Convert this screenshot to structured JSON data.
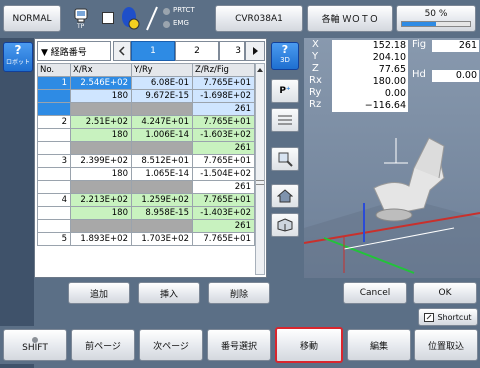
{
  "header": {
    "mode_label": "NORMAL",
    "tp_label": "TP",
    "prtct_label": "PRTCT",
    "emg_label": "EMG",
    "robot_name": "CVR038A1",
    "axis_label": "各軸 ＷＯＴＯ",
    "speed_label": "50 %",
    "speed_value": 0.5
  },
  "left_panel": {
    "robot_button_label": "ロボット",
    "help_glyph": "?"
  },
  "table": {
    "title": "▼ 経路番号",
    "tabs": [
      "1",
      "2",
      "3"
    ],
    "active_tab": "1",
    "col_headers": [
      "No.",
      "X/Rx",
      "Y/Ry",
      "Z/Rz/Fig"
    ],
    "rows": [
      {
        "no": "1",
        "r1": [
          "2.546E+02",
          "6.08E-01",
          "7.765E+01"
        ],
        "r2": [
          "180",
          "9.672E-15",
          "-1.698E+02"
        ],
        "r3": "261"
      },
      {
        "no": "2",
        "r1": [
          "2.51E+02",
          "4.247E+01",
          "7.765E+01"
        ],
        "r2": [
          "180",
          "1.006E-14",
          "-1.603E+02"
        ],
        "r3": "261"
      },
      {
        "no": "3",
        "r1": [
          "2.399E+02",
          "8.512E+01",
          "7.765E+01"
        ],
        "r2": [
          "180",
          "1.065E-14",
          "-1.504E+02"
        ],
        "r3": "261"
      },
      {
        "no": "4",
        "r1": [
          "2.213E+02",
          "1.259E+02",
          "7.765E+01"
        ],
        "r2": [
          "180",
          "8.958E-15",
          "-1.403E+02"
        ],
        "r3": "261"
      },
      {
        "no": "5",
        "r1": [
          "1.893E+02",
          "1.703E+02",
          "7.765E+01"
        ]
      }
    ]
  },
  "side_tools": {
    "view3d_label": "3D",
    "help_glyph": "?"
  },
  "position": {
    "X": "152.18",
    "Y": "204.10",
    "Z": "77.65",
    "Rx": "180.00",
    "Ry": "0.00",
    "Rz": "−116.64",
    "fig_label": "Fig",
    "fig_value": "261",
    "hd_label": "Hd",
    "hd_value": "0.00",
    "labels": [
      "X",
      "Y",
      "Z",
      "Rx",
      "Ry",
      "Rz"
    ]
  },
  "action_row": {
    "add": "追加",
    "insert": "挿入",
    "delete": "削除",
    "cancel": "Cancel",
    "ok": "OK",
    "shortcut": "Shortcut"
  },
  "bottom": {
    "shift": "SHIFT",
    "prev": "前ページ",
    "next": "次ページ",
    "select": "番号選択",
    "move": "移動",
    "edit": "編集",
    "pos_take": "位置取込"
  },
  "colors": {
    "accent_red": "#d9262e",
    "selected_blue": "#2e8be4",
    "green_cell": "#c8f2bf",
    "viewport_bg": "#7c8da4"
  }
}
